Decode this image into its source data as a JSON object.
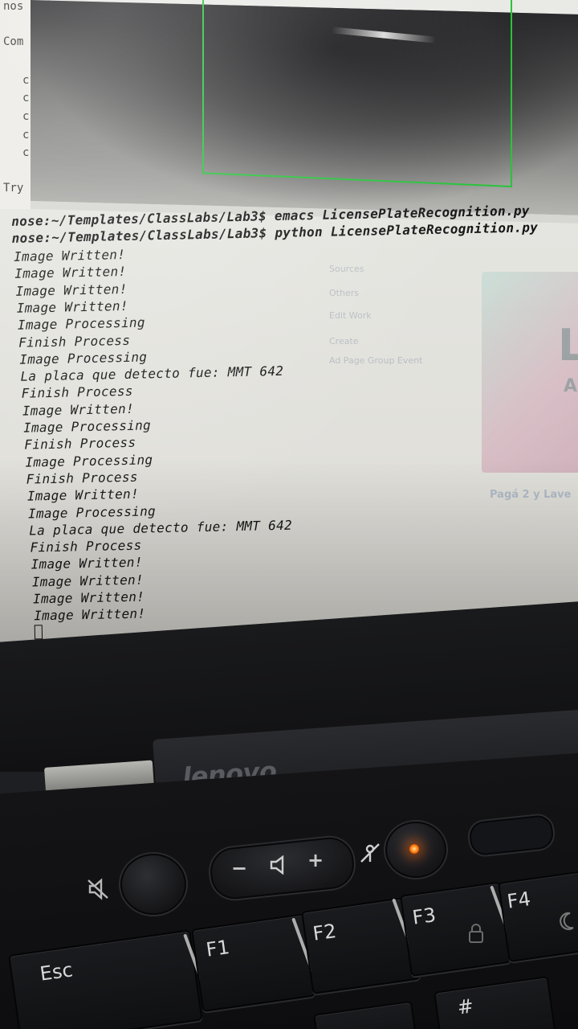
{
  "terminal": {
    "prompt_1": "nose:~/Templates/ClassLabs/Lab3$ emacs LicensePlateRecognition.py",
    "prompt_2": "nose:~/Templates/ClassLabs/Lab3$ python LicensePlateRecognition.py",
    "output": [
      "Image Written!",
      "Image Written!",
      "Image Written!",
      "Image Written!",
      "Image Processing",
      "Finish Process",
      "Image Processing",
      "La placa que detecto fue: MMT 642",
      "Finish Process",
      "Image Written!",
      "Image Processing",
      "Finish Process",
      "Image Processing",
      "Finish Process",
      "Image Written!",
      "Image Processing",
      "La placa que detecto fue: MMT 642",
      "Finish Process",
      "Image Written!",
      "Image Written!",
      "Image Written!",
      "Image Written!"
    ]
  },
  "background_window": {
    "title_fragment": "nos",
    "label_fragment": "Com",
    "items": [
      "c",
      "c",
      "c",
      "c",
      "c"
    ],
    "footer_fragment": "Try"
  },
  "camera_preview": {
    "detection_box_color": "#27c43a"
  },
  "ghost_browser": {
    "menu": [
      "Sources",
      "Others",
      "Edit Work",
      "Create",
      "Ad  Page  Group  Event"
    ],
    "card_letter": "L",
    "card_sub": "A",
    "caption": "Pagá 2 y Lave"
  },
  "laptop": {
    "brand": "lenovo",
    "controls": {
      "vol_down": "−",
      "vol_up": "+",
      "speaker_icon": "speaker-icon",
      "mic_mute_icon": "mic-mute-icon"
    },
    "keys": {
      "esc": "Esc",
      "f1": "F1",
      "f2": "F2",
      "f3": "F3",
      "f4": "F4",
      "hash": "#"
    },
    "led_color": "#ff7a10"
  }
}
